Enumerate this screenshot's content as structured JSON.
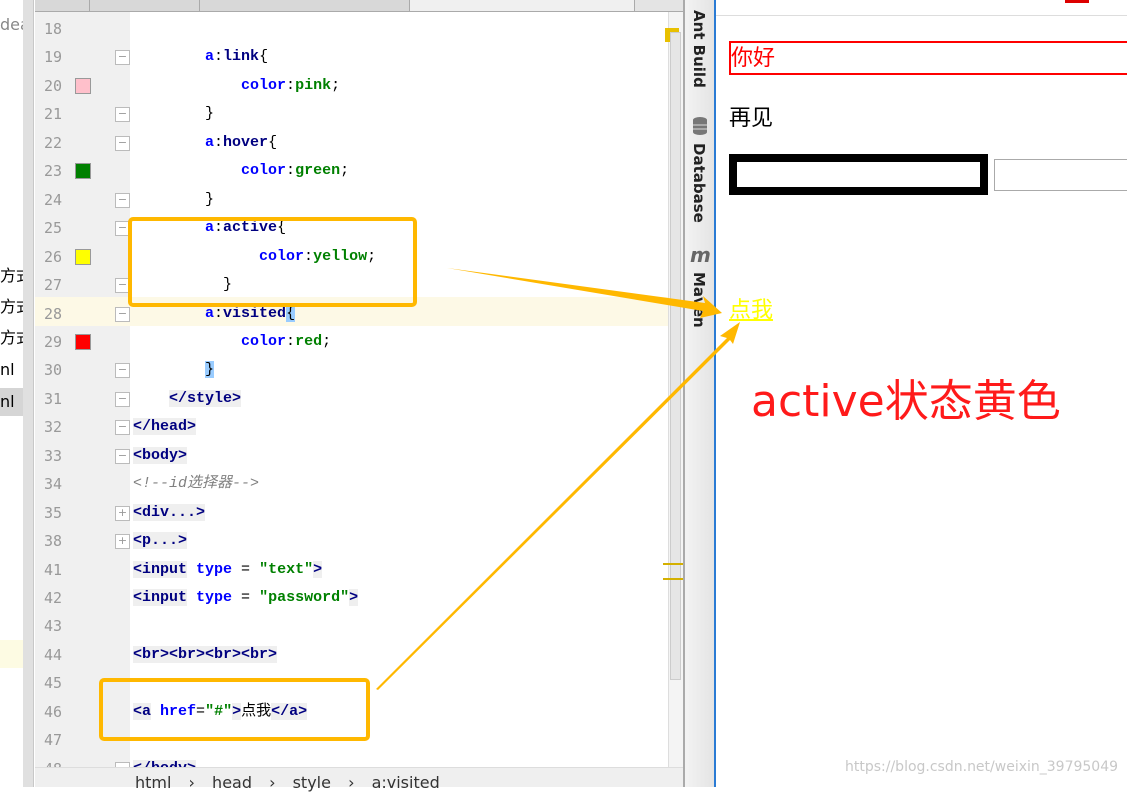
{
  "project_panel": {
    "items": [
      "deav",
      "方式",
      "方式",
      "方式",
      "nl",
      "nl"
    ]
  },
  "editor": {
    "lines": [
      {
        "n": "18",
        "tokens": []
      },
      {
        "n": "19",
        "tokens": [
          [
            "x",
            "        "
          ],
          [
            "p",
            "a"
          ],
          [
            "x",
            ":"
          ],
          [
            "t2",
            "link"
          ],
          [
            "br",
            "{"
          ]
        ]
      },
      {
        "n": "20",
        "swatch": "#ffc0cb",
        "tokens": [
          [
            "x",
            "            "
          ],
          [
            "p",
            "color"
          ],
          [
            "x",
            ":"
          ],
          [
            "v",
            "pink"
          ],
          [
            "x",
            ";"
          ]
        ]
      },
      {
        "n": "21",
        "tokens": [
          [
            "x",
            "        "
          ],
          [
            "br",
            "}"
          ]
        ]
      },
      {
        "n": "22",
        "tokens": [
          [
            "x",
            "        "
          ],
          [
            "p",
            "a"
          ],
          [
            "x",
            ":"
          ],
          [
            "t2",
            "hover"
          ],
          [
            "br",
            "{"
          ]
        ]
      },
      {
        "n": "23",
        "swatch": "#008000",
        "tokens": [
          [
            "x",
            "            "
          ],
          [
            "p",
            "color"
          ],
          [
            "x",
            ":"
          ],
          [
            "v",
            "green"
          ],
          [
            "x",
            ";"
          ]
        ]
      },
      {
        "n": "24",
        "tokens": [
          [
            "x",
            "        "
          ],
          [
            "br",
            "}"
          ]
        ]
      },
      {
        "n": "25",
        "tokens": [
          [
            "x",
            "        "
          ],
          [
            "p",
            "a"
          ],
          [
            "x",
            ":"
          ],
          [
            "t2",
            "active"
          ],
          [
            "br",
            "{"
          ]
        ]
      },
      {
        "n": "26",
        "swatch": "#ffff00",
        "tokens": [
          [
            "x",
            "              "
          ],
          [
            "p",
            "color"
          ],
          [
            "x",
            ":"
          ],
          [
            "v",
            "yellow"
          ],
          [
            "x",
            ";"
          ]
        ]
      },
      {
        "n": "27",
        "tokens": [
          [
            "x",
            "          "
          ],
          [
            "br",
            "}"
          ]
        ]
      },
      {
        "n": "28",
        "tokens": [
          [
            "x",
            "        "
          ],
          [
            "p",
            "a"
          ],
          [
            "x",
            ":"
          ],
          [
            "t2",
            "visited"
          ],
          [
            "sb",
            "{"
          ]
        ]
      },
      {
        "n": "29",
        "swatch": "#ff0000",
        "tokens": [
          [
            "x",
            "            "
          ],
          [
            "p",
            "color"
          ],
          [
            "x",
            ":"
          ],
          [
            "v",
            "red"
          ],
          [
            "x",
            ";"
          ]
        ]
      },
      {
        "n": "30",
        "tokens": [
          [
            "x",
            "        "
          ],
          [
            "sb",
            "}"
          ]
        ]
      },
      {
        "n": "31",
        "tokens": [
          [
            "x",
            "    "
          ],
          [
            "t",
            "</style>"
          ]
        ]
      },
      {
        "n": "32",
        "tokens": [
          [
            "t",
            "</head>"
          ]
        ]
      },
      {
        "n": "33",
        "tokens": [
          [
            "t",
            "<body>"
          ]
        ]
      },
      {
        "n": "34",
        "tokens": [
          [
            "c",
            "<!--id选择器-->"
          ]
        ]
      },
      {
        "n": "35",
        "tokens": [
          [
            "t",
            "<div...>"
          ]
        ]
      },
      {
        "n": "38",
        "tokens": [
          [
            "t",
            "<p...>"
          ]
        ]
      },
      {
        "n": "41",
        "tokens": [
          [
            "t",
            "<input"
          ],
          [
            "x",
            " "
          ],
          [
            "a",
            "type"
          ],
          [
            "x",
            " = "
          ],
          [
            "s",
            "\"text\""
          ],
          [
            "t",
            ">"
          ]
        ]
      },
      {
        "n": "42",
        "tokens": [
          [
            "t",
            "<input"
          ],
          [
            "x",
            " "
          ],
          [
            "a",
            "type"
          ],
          [
            "x",
            " = "
          ],
          [
            "s",
            "\"password\""
          ],
          [
            "t",
            ">"
          ]
        ]
      },
      {
        "n": "43",
        "tokens": []
      },
      {
        "n": "44",
        "tokens": [
          [
            "t",
            "<br><br><br><br>"
          ]
        ]
      },
      {
        "n": "45",
        "tokens": []
      },
      {
        "n": "46",
        "tokens": [
          [
            "t",
            "<a"
          ],
          [
            "x",
            " "
          ],
          [
            "a",
            "href"
          ],
          [
            "x",
            "="
          ],
          [
            "s",
            "\"#\""
          ],
          [
            "t",
            ">"
          ],
          [
            "x",
            "点我"
          ],
          [
            "t",
            "</a>"
          ]
        ]
      },
      {
        "n": "47",
        "tokens": []
      },
      {
        "n": "48",
        "tokens": [
          [
            "t",
            "</body>"
          ]
        ]
      }
    ]
  },
  "breadcrumb": [
    "html",
    "›",
    "head",
    "›",
    "style",
    "›",
    "a:visited"
  ],
  "tool_windows": [
    "Ant Build",
    "Database",
    "Maven"
  ],
  "tool_icons": [
    "ant-icon",
    "database-icon",
    "maven-icon"
  ],
  "browser": {
    "hello": "你好",
    "bye": "再见",
    "link": "点我",
    "link_color": "#ffff00"
  },
  "annotation": {
    "text": "active状态黄色",
    "color": "#ff1a1a",
    "highlight_color": "#ffb800"
  },
  "watermark": "https://blog.csdn.net/weixin_39795049"
}
